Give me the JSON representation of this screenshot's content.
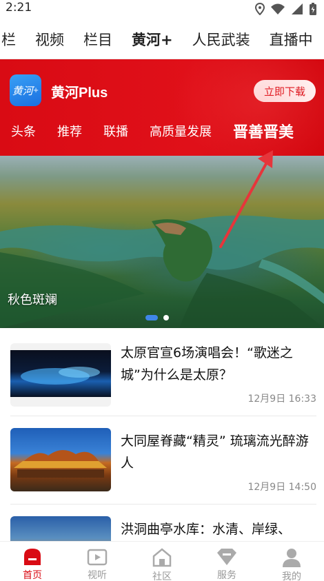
{
  "status": {
    "time": "2:21"
  },
  "top_nav": {
    "tabs": [
      "栏",
      "视频",
      "栏目",
      "黄河+",
      "人民武装",
      "直播中"
    ]
  },
  "app_banner": {
    "logo_text": "黄河",
    "name": "黄河Plus",
    "download_label": "立即下载",
    "sub_tabs": [
      "头条",
      "推荐",
      "联播",
      "高质量发展",
      "晋善晋美"
    ],
    "active_sub_tab": "晋善晋美"
  },
  "carousel": {
    "caption": "秋色斑斓",
    "page": 1,
    "page_count": 2
  },
  "news": [
    {
      "title": "太原官宣6场演唱会！“歌迷之城”为什么是太原？",
      "time": "12月9日 16:33"
    },
    {
      "title": "大同屋脊藏“精灵” 琉璃流光醉游人",
      "time": "12月9日 14:50"
    },
    {
      "title": "洪洞曲亭水库：水清、岸绿、",
      "time": ""
    }
  ],
  "bottom_nav": [
    {
      "label": "首页",
      "icon": "home-icon",
      "active": true
    },
    {
      "label": "视听",
      "icon": "video-icon",
      "active": false
    },
    {
      "label": "社区",
      "icon": "community-icon",
      "active": false
    },
    {
      "label": "服务",
      "icon": "service-icon",
      "active": false
    },
    {
      "label": "我的",
      "icon": "profile-icon",
      "active": false
    }
  ],
  "colors": {
    "brand_red": "#d90b14",
    "carousel_active": "#3f86e8",
    "inactive_gray": "#999999"
  }
}
